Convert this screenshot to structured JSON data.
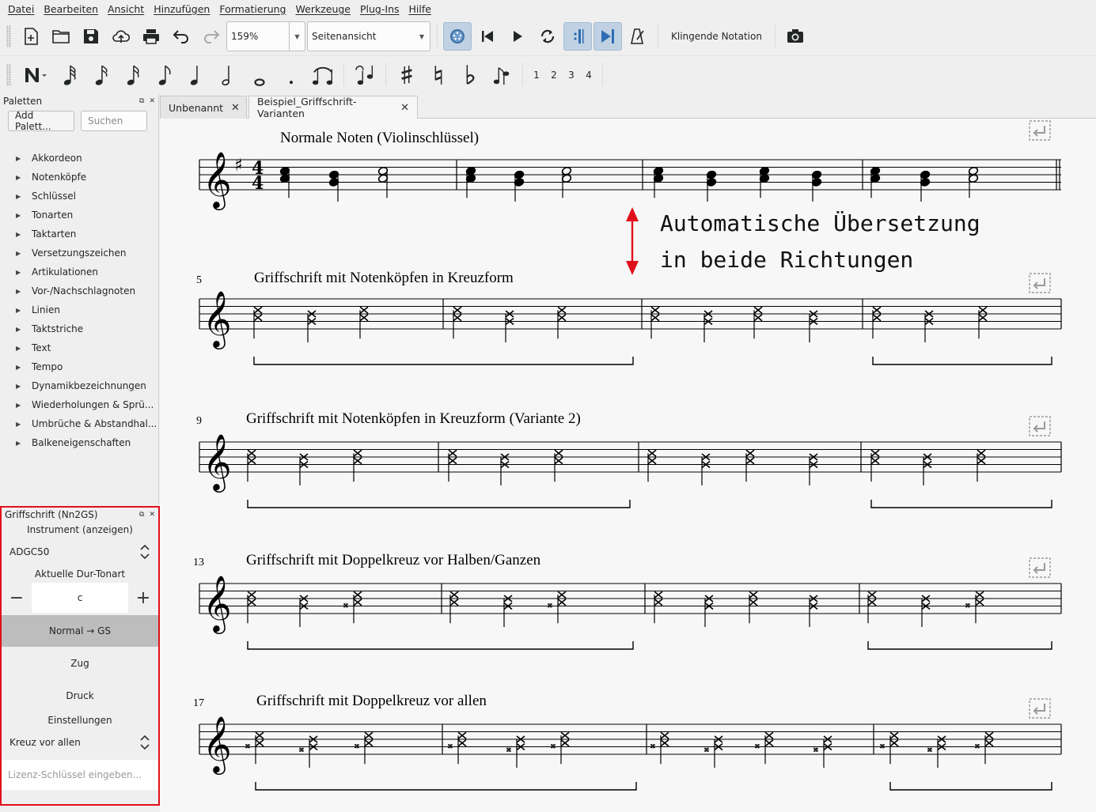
{
  "menu": [
    "Datei",
    "Bearbeiten",
    "Ansicht",
    "Hinzufügen",
    "Formatierung",
    "Werkzeuge",
    "Plug-Ins",
    "Hilfe"
  ],
  "toolbar": {
    "zoom": "159%",
    "view_mode": "Seitenansicht",
    "concert_pitch": "Klingende Notation",
    "voices": [
      "1",
      "2",
      "3",
      "4"
    ]
  },
  "palettes": {
    "title": "Paletten",
    "add_button": "Add Palett...",
    "search_placeholder": "Suchen",
    "items": [
      "Akkordeon",
      "Notenköpfe",
      "Schlüssel",
      "Tonarten",
      "Taktarten",
      "Versetzungszeichen",
      "Artikulationen",
      "Vor-/Nachschlagnoten",
      "Linien",
      "Taktstriche",
      "Text",
      "Tempo",
      "Dynamikbezeichnungen",
      "Wiederholungen & Sprü...",
      "Umbrüche & Abstandhal...",
      "Balkeneigenschaften"
    ]
  },
  "griffschrift": {
    "title": "Griffschrift (Nn2GS)",
    "instrument_label": "Instrument (anzeigen)",
    "instrument_value": "ADGC50",
    "key_label": "Aktuelle Dur-Tonart",
    "key_value": "c",
    "minus": "−",
    "plus": "+",
    "btn_normal_gs": "Normal → GS",
    "btn_zug": "Zug",
    "btn_druck": "Druck",
    "settings_label": "Einstellungen",
    "settings_value": "Kreuz vor allen",
    "license_placeholder": "Lizenz-Schlüssel eingeben..."
  },
  "tabs": [
    "Unbenannt",
    "Beispiel_Griffschrift-Varianten"
  ],
  "score": {
    "annotation_line1": "Automatische Übersetzung",
    "annotation_line2": "in beide Richtungen",
    "systems": [
      {
        "title": "Normale Noten (Violinschlüssel)",
        "measure": ""
      },
      {
        "title": "Griffschrift mit Notenköpfen in Kreuzform",
        "measure": "5"
      },
      {
        "title": "Griffschrift mit Notenköpfen in Kreuzform (Variante 2)",
        "measure": "9"
      },
      {
        "title": "Griffschrift mit Doppelkreuz vor Halben/Ganzen",
        "measure": "13"
      },
      {
        "title": "Griffschrift mit Doppelkreuz vor allen",
        "measure": "17"
      }
    ]
  }
}
